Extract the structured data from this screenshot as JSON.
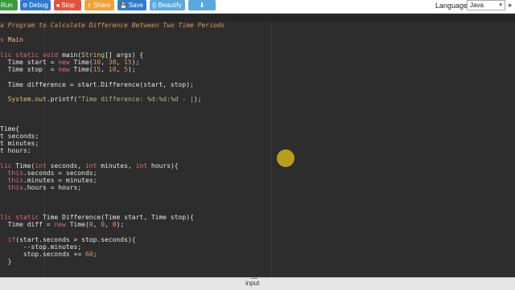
{
  "toolbar": {
    "run_label": "Run",
    "debug_label": "Debug",
    "stop_label": "Stop",
    "share_label": "Share",
    "save_label": "Save",
    "beautify_label": "{} Beautify",
    "language_label": "Language",
    "language_value": "Java",
    "colors": {
      "run": "#3c9a3c",
      "debug": "#2e7bc9",
      "stop": "#e0533d",
      "share": "#f0a23a",
      "save": "#2e7bc9",
      "beautify": "#5aa8e0",
      "download": "#5aa8e0"
    }
  },
  "editor": {
    "lines": [
      [
        [
          "a Program to Calculate Difference Between Two Time Periods",
          "comment"
        ]
      ],
      [],
      [
        [
          "s ",
          "kw"
        ],
        [
          "Main",
          "type"
        ]
      ],
      [],
      [
        [
          "lic static void ",
          "kw"
        ],
        [
          "main(",
          "plain"
        ],
        [
          "String",
          "type"
        ],
        [
          "[] args) {",
          "plain"
        ]
      ],
      [
        [
          "  Time start = ",
          "plain"
        ],
        [
          "new ",
          "kw"
        ],
        [
          "Time(",
          "plain"
        ],
        [
          "10",
          "num"
        ],
        [
          ", ",
          "plain"
        ],
        [
          "30",
          "num"
        ],
        [
          ", ",
          "plain"
        ],
        [
          "15",
          "num"
        ],
        [
          ");",
          "plain"
        ]
      ],
      [
        [
          "  Time stop  = ",
          "plain"
        ],
        [
          "new ",
          "kw"
        ],
        [
          "Time(",
          "plain"
        ],
        [
          "15",
          "num"
        ],
        [
          ", ",
          "plain"
        ],
        [
          "10",
          "num"
        ],
        [
          ", ",
          "plain"
        ],
        [
          "5",
          "num"
        ],
        [
          ");",
          "plain"
        ]
      ],
      [],
      [
        [
          "  Time difference = start.Difference(start, stop);",
          "plain"
        ]
      ],
      [],
      [
        [
          "  System",
          "type"
        ],
        [
          ".",
          "plain"
        ],
        [
          "out",
          "type"
        ],
        [
          ".printf(",
          "plain"
        ],
        [
          "\"Time difference: %d:%d:%d - |",
          "str"
        ],
        [
          ");",
          "plain"
        ]
      ],
      [],
      [],
      [],
      [
        [
          "Time{",
          "plain"
        ]
      ],
      [
        [
          "t seconds;",
          "plain"
        ]
      ],
      [
        [
          "t minutes;",
          "plain"
        ]
      ],
      [
        [
          "t hours;",
          "plain"
        ]
      ],
      [],
      [
        [
          "lic ",
          "kw"
        ],
        [
          "Time(",
          "plain"
        ],
        [
          "int ",
          "kw"
        ],
        [
          "seconds, ",
          "plain"
        ],
        [
          "int ",
          "kw"
        ],
        [
          "minutes, ",
          "plain"
        ],
        [
          "int ",
          "kw"
        ],
        [
          "hours){",
          "plain"
        ]
      ],
      [
        [
          "  this",
          "kw"
        ],
        [
          ".seconds = seconds;",
          "plain"
        ]
      ],
      [
        [
          "  this",
          "kw"
        ],
        [
          ".minutes = minutes;",
          "plain"
        ]
      ],
      [
        [
          "  this",
          "kw"
        ],
        [
          ".hours = hours;",
          "plain"
        ]
      ],
      [],
      [],
      [],
      [
        [
          "lic static ",
          "kw"
        ],
        [
          "Time Difference(Time start, Time stop){",
          "plain"
        ]
      ],
      [
        [
          "  Time diff = ",
          "plain"
        ],
        [
          "new ",
          "kw"
        ],
        [
          "Time(",
          "plain"
        ],
        [
          "0",
          "num"
        ],
        [
          ", ",
          "plain"
        ],
        [
          "0",
          "num"
        ],
        [
          ", ",
          "plain"
        ],
        [
          "0",
          "num"
        ],
        [
          ");",
          "plain"
        ]
      ],
      [],
      [
        [
          "  if",
          "kw"
        ],
        [
          "(start.seconds > stop.seconds){",
          "plain"
        ]
      ],
      [
        [
          "      --stop.minutes;",
          "plain"
        ]
      ],
      [
        [
          "      stop.seconds += ",
          "plain"
        ],
        [
          "60",
          "num"
        ],
        [
          ";",
          "plain"
        ]
      ],
      [
        [
          "  }",
          "plain"
        ]
      ]
    ]
  },
  "bottom": {
    "input_label": "input"
  }
}
